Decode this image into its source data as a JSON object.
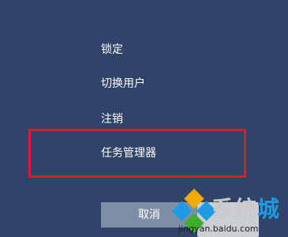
{
  "menu": {
    "items": [
      {
        "label": "锁定"
      },
      {
        "label": "切换用户"
      },
      {
        "label": "注销"
      },
      {
        "label": "任务管理器"
      }
    ]
  },
  "cancel_label": "取消",
  "watermark": {
    "brand_parts": [
      "系",
      "统",
      "城"
    ],
    "url": "jingyan.baidu.com"
  },
  "colors": {
    "background": "#2f4468",
    "highlight": "#d81e2a",
    "button": "#7f8ea7"
  }
}
